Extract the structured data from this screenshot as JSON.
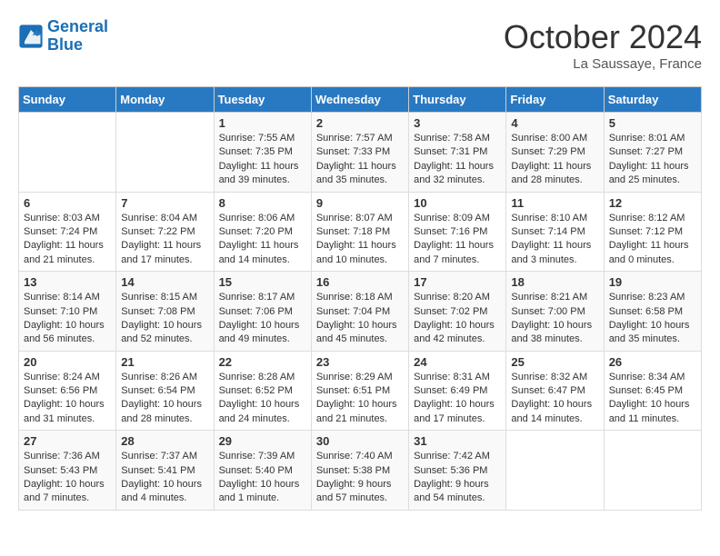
{
  "logo": {
    "line1": "General",
    "line2": "Blue"
  },
  "title": "October 2024",
  "subtitle": "La Saussaye, France",
  "days_of_week": [
    "Sunday",
    "Monday",
    "Tuesday",
    "Wednesday",
    "Thursday",
    "Friday",
    "Saturday"
  ],
  "weeks": [
    [
      {
        "day": "",
        "info": ""
      },
      {
        "day": "",
        "info": ""
      },
      {
        "day": "1",
        "sunrise": "Sunrise: 7:55 AM",
        "sunset": "Sunset: 7:35 PM",
        "daylight": "Daylight: 11 hours and 39 minutes."
      },
      {
        "day": "2",
        "sunrise": "Sunrise: 7:57 AM",
        "sunset": "Sunset: 7:33 PM",
        "daylight": "Daylight: 11 hours and 35 minutes."
      },
      {
        "day": "3",
        "sunrise": "Sunrise: 7:58 AM",
        "sunset": "Sunset: 7:31 PM",
        "daylight": "Daylight: 11 hours and 32 minutes."
      },
      {
        "day": "4",
        "sunrise": "Sunrise: 8:00 AM",
        "sunset": "Sunset: 7:29 PM",
        "daylight": "Daylight: 11 hours and 28 minutes."
      },
      {
        "day": "5",
        "sunrise": "Sunrise: 8:01 AM",
        "sunset": "Sunset: 7:27 PM",
        "daylight": "Daylight: 11 hours and 25 minutes."
      }
    ],
    [
      {
        "day": "6",
        "sunrise": "Sunrise: 8:03 AM",
        "sunset": "Sunset: 7:24 PM",
        "daylight": "Daylight: 11 hours and 21 minutes."
      },
      {
        "day": "7",
        "sunrise": "Sunrise: 8:04 AM",
        "sunset": "Sunset: 7:22 PM",
        "daylight": "Daylight: 11 hours and 17 minutes."
      },
      {
        "day": "8",
        "sunrise": "Sunrise: 8:06 AM",
        "sunset": "Sunset: 7:20 PM",
        "daylight": "Daylight: 11 hours and 14 minutes."
      },
      {
        "day": "9",
        "sunrise": "Sunrise: 8:07 AM",
        "sunset": "Sunset: 7:18 PM",
        "daylight": "Daylight: 11 hours and 10 minutes."
      },
      {
        "day": "10",
        "sunrise": "Sunrise: 8:09 AM",
        "sunset": "Sunset: 7:16 PM",
        "daylight": "Daylight: 11 hours and 7 minutes."
      },
      {
        "day": "11",
        "sunrise": "Sunrise: 8:10 AM",
        "sunset": "Sunset: 7:14 PM",
        "daylight": "Daylight: 11 hours and 3 minutes."
      },
      {
        "day": "12",
        "sunrise": "Sunrise: 8:12 AM",
        "sunset": "Sunset: 7:12 PM",
        "daylight": "Daylight: 11 hours and 0 minutes."
      }
    ],
    [
      {
        "day": "13",
        "sunrise": "Sunrise: 8:14 AM",
        "sunset": "Sunset: 7:10 PM",
        "daylight": "Daylight: 10 hours and 56 minutes."
      },
      {
        "day": "14",
        "sunrise": "Sunrise: 8:15 AM",
        "sunset": "Sunset: 7:08 PM",
        "daylight": "Daylight: 10 hours and 52 minutes."
      },
      {
        "day": "15",
        "sunrise": "Sunrise: 8:17 AM",
        "sunset": "Sunset: 7:06 PM",
        "daylight": "Daylight: 10 hours and 49 minutes."
      },
      {
        "day": "16",
        "sunrise": "Sunrise: 8:18 AM",
        "sunset": "Sunset: 7:04 PM",
        "daylight": "Daylight: 10 hours and 45 minutes."
      },
      {
        "day": "17",
        "sunrise": "Sunrise: 8:20 AM",
        "sunset": "Sunset: 7:02 PM",
        "daylight": "Daylight: 10 hours and 42 minutes."
      },
      {
        "day": "18",
        "sunrise": "Sunrise: 8:21 AM",
        "sunset": "Sunset: 7:00 PM",
        "daylight": "Daylight: 10 hours and 38 minutes."
      },
      {
        "day": "19",
        "sunrise": "Sunrise: 8:23 AM",
        "sunset": "Sunset: 6:58 PM",
        "daylight": "Daylight: 10 hours and 35 minutes."
      }
    ],
    [
      {
        "day": "20",
        "sunrise": "Sunrise: 8:24 AM",
        "sunset": "Sunset: 6:56 PM",
        "daylight": "Daylight: 10 hours and 31 minutes."
      },
      {
        "day": "21",
        "sunrise": "Sunrise: 8:26 AM",
        "sunset": "Sunset: 6:54 PM",
        "daylight": "Daylight: 10 hours and 28 minutes."
      },
      {
        "day": "22",
        "sunrise": "Sunrise: 8:28 AM",
        "sunset": "Sunset: 6:52 PM",
        "daylight": "Daylight: 10 hours and 24 minutes."
      },
      {
        "day": "23",
        "sunrise": "Sunrise: 8:29 AM",
        "sunset": "Sunset: 6:51 PM",
        "daylight": "Daylight: 10 hours and 21 minutes."
      },
      {
        "day": "24",
        "sunrise": "Sunrise: 8:31 AM",
        "sunset": "Sunset: 6:49 PM",
        "daylight": "Daylight: 10 hours and 17 minutes."
      },
      {
        "day": "25",
        "sunrise": "Sunrise: 8:32 AM",
        "sunset": "Sunset: 6:47 PM",
        "daylight": "Daylight: 10 hours and 14 minutes."
      },
      {
        "day": "26",
        "sunrise": "Sunrise: 8:34 AM",
        "sunset": "Sunset: 6:45 PM",
        "daylight": "Daylight: 10 hours and 11 minutes."
      }
    ],
    [
      {
        "day": "27",
        "sunrise": "Sunrise: 7:36 AM",
        "sunset": "Sunset: 5:43 PM",
        "daylight": "Daylight: 10 hours and 7 minutes."
      },
      {
        "day": "28",
        "sunrise": "Sunrise: 7:37 AM",
        "sunset": "Sunset: 5:41 PM",
        "daylight": "Daylight: 10 hours and 4 minutes."
      },
      {
        "day": "29",
        "sunrise": "Sunrise: 7:39 AM",
        "sunset": "Sunset: 5:40 PM",
        "daylight": "Daylight: 10 hours and 1 minute."
      },
      {
        "day": "30",
        "sunrise": "Sunrise: 7:40 AM",
        "sunset": "Sunset: 5:38 PM",
        "daylight": "Daylight: 9 hours and 57 minutes."
      },
      {
        "day": "31",
        "sunrise": "Sunrise: 7:42 AM",
        "sunset": "Sunset: 5:36 PM",
        "daylight": "Daylight: 9 hours and 54 minutes."
      },
      {
        "day": "",
        "info": ""
      },
      {
        "day": "",
        "info": ""
      }
    ]
  ]
}
